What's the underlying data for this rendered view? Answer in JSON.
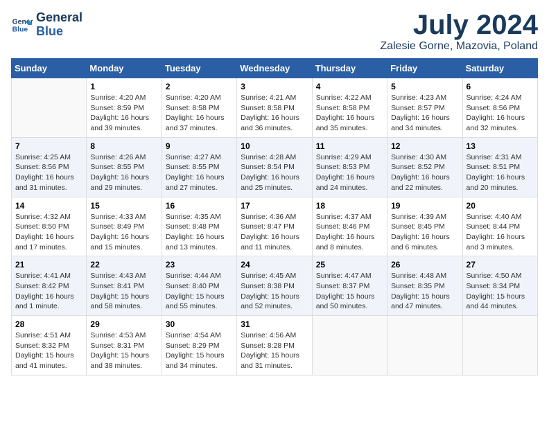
{
  "header": {
    "logo_line1": "General",
    "logo_line2": "Blue",
    "month_year": "July 2024",
    "location": "Zalesie Gorne, Mazovia, Poland"
  },
  "weekdays": [
    "Sunday",
    "Monday",
    "Tuesday",
    "Wednesday",
    "Thursday",
    "Friday",
    "Saturday"
  ],
  "weeks": [
    [
      {
        "day": "",
        "info": ""
      },
      {
        "day": "1",
        "info": "Sunrise: 4:20 AM\nSunset: 8:59 PM\nDaylight: 16 hours\nand 39 minutes."
      },
      {
        "day": "2",
        "info": "Sunrise: 4:20 AM\nSunset: 8:58 PM\nDaylight: 16 hours\nand 37 minutes."
      },
      {
        "day": "3",
        "info": "Sunrise: 4:21 AM\nSunset: 8:58 PM\nDaylight: 16 hours\nand 36 minutes."
      },
      {
        "day": "4",
        "info": "Sunrise: 4:22 AM\nSunset: 8:58 PM\nDaylight: 16 hours\nand 35 minutes."
      },
      {
        "day": "5",
        "info": "Sunrise: 4:23 AM\nSunset: 8:57 PM\nDaylight: 16 hours\nand 34 minutes."
      },
      {
        "day": "6",
        "info": "Sunrise: 4:24 AM\nSunset: 8:56 PM\nDaylight: 16 hours\nand 32 minutes."
      }
    ],
    [
      {
        "day": "7",
        "info": "Sunrise: 4:25 AM\nSunset: 8:56 PM\nDaylight: 16 hours\nand 31 minutes."
      },
      {
        "day": "8",
        "info": "Sunrise: 4:26 AM\nSunset: 8:55 PM\nDaylight: 16 hours\nand 29 minutes."
      },
      {
        "day": "9",
        "info": "Sunrise: 4:27 AM\nSunset: 8:55 PM\nDaylight: 16 hours\nand 27 minutes."
      },
      {
        "day": "10",
        "info": "Sunrise: 4:28 AM\nSunset: 8:54 PM\nDaylight: 16 hours\nand 25 minutes."
      },
      {
        "day": "11",
        "info": "Sunrise: 4:29 AM\nSunset: 8:53 PM\nDaylight: 16 hours\nand 24 minutes."
      },
      {
        "day": "12",
        "info": "Sunrise: 4:30 AM\nSunset: 8:52 PM\nDaylight: 16 hours\nand 22 minutes."
      },
      {
        "day": "13",
        "info": "Sunrise: 4:31 AM\nSunset: 8:51 PM\nDaylight: 16 hours\nand 20 minutes."
      }
    ],
    [
      {
        "day": "14",
        "info": "Sunrise: 4:32 AM\nSunset: 8:50 PM\nDaylight: 16 hours\nand 17 minutes."
      },
      {
        "day": "15",
        "info": "Sunrise: 4:33 AM\nSunset: 8:49 PM\nDaylight: 16 hours\nand 15 minutes."
      },
      {
        "day": "16",
        "info": "Sunrise: 4:35 AM\nSunset: 8:48 PM\nDaylight: 16 hours\nand 13 minutes."
      },
      {
        "day": "17",
        "info": "Sunrise: 4:36 AM\nSunset: 8:47 PM\nDaylight: 16 hours\nand 11 minutes."
      },
      {
        "day": "18",
        "info": "Sunrise: 4:37 AM\nSunset: 8:46 PM\nDaylight: 16 hours\nand 8 minutes."
      },
      {
        "day": "19",
        "info": "Sunrise: 4:39 AM\nSunset: 8:45 PM\nDaylight: 16 hours\nand 6 minutes."
      },
      {
        "day": "20",
        "info": "Sunrise: 4:40 AM\nSunset: 8:44 PM\nDaylight: 16 hours\nand 3 minutes."
      }
    ],
    [
      {
        "day": "21",
        "info": "Sunrise: 4:41 AM\nSunset: 8:42 PM\nDaylight: 16 hours\nand 1 minute."
      },
      {
        "day": "22",
        "info": "Sunrise: 4:43 AM\nSunset: 8:41 PM\nDaylight: 15 hours\nand 58 minutes."
      },
      {
        "day": "23",
        "info": "Sunrise: 4:44 AM\nSunset: 8:40 PM\nDaylight: 15 hours\nand 55 minutes."
      },
      {
        "day": "24",
        "info": "Sunrise: 4:45 AM\nSunset: 8:38 PM\nDaylight: 15 hours\nand 52 minutes."
      },
      {
        "day": "25",
        "info": "Sunrise: 4:47 AM\nSunset: 8:37 PM\nDaylight: 15 hours\nand 50 minutes."
      },
      {
        "day": "26",
        "info": "Sunrise: 4:48 AM\nSunset: 8:35 PM\nDaylight: 15 hours\nand 47 minutes."
      },
      {
        "day": "27",
        "info": "Sunrise: 4:50 AM\nSunset: 8:34 PM\nDaylight: 15 hours\nand 44 minutes."
      }
    ],
    [
      {
        "day": "28",
        "info": "Sunrise: 4:51 AM\nSunset: 8:32 PM\nDaylight: 15 hours\nand 41 minutes."
      },
      {
        "day": "29",
        "info": "Sunrise: 4:53 AM\nSunset: 8:31 PM\nDaylight: 15 hours\nand 38 minutes."
      },
      {
        "day": "30",
        "info": "Sunrise: 4:54 AM\nSunset: 8:29 PM\nDaylight: 15 hours\nand 34 minutes."
      },
      {
        "day": "31",
        "info": "Sunrise: 4:56 AM\nSunset: 8:28 PM\nDaylight: 15 hours\nand 31 minutes."
      },
      {
        "day": "",
        "info": ""
      },
      {
        "day": "",
        "info": ""
      },
      {
        "day": "",
        "info": ""
      }
    ]
  ]
}
